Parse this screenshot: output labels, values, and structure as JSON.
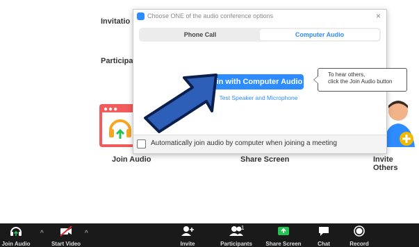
{
  "background": {
    "invitation_label": "Invitatio",
    "participants_label": "Participa",
    "tiles": {
      "join_audio": "Join Audio",
      "share_screen": "Share Screen",
      "invite_others": "Invite Others"
    }
  },
  "dialog": {
    "title": "Choose ONE of the audio conference options",
    "close": "×",
    "tabs": [
      {
        "label": "Phone Call",
        "selected": false
      },
      {
        "label": "Computer Audio",
        "selected": true
      }
    ],
    "join_button": "Join with Computer Audio",
    "test_link": "Test Speaker and Microphone",
    "auto_join_label": "Automatically join audio by computer when joining a meeting",
    "auto_join_checked": false
  },
  "tooltip": {
    "line1": "To hear others,",
    "line2": "click the Join Audio button"
  },
  "toolbar": {
    "join_audio": "Join Audio",
    "start_video": "Start Video",
    "invite": "Invite",
    "participants": "Participants",
    "participants_count": "1",
    "share_screen": "Share Screen",
    "chat": "Chat",
    "record": "Record",
    "caret": "^"
  },
  "colors": {
    "accent": "#2d8cff",
    "toolbar_bg": "#1a1a1a",
    "share_green": "#26c155",
    "join_tile_red": "#f25b5b"
  }
}
